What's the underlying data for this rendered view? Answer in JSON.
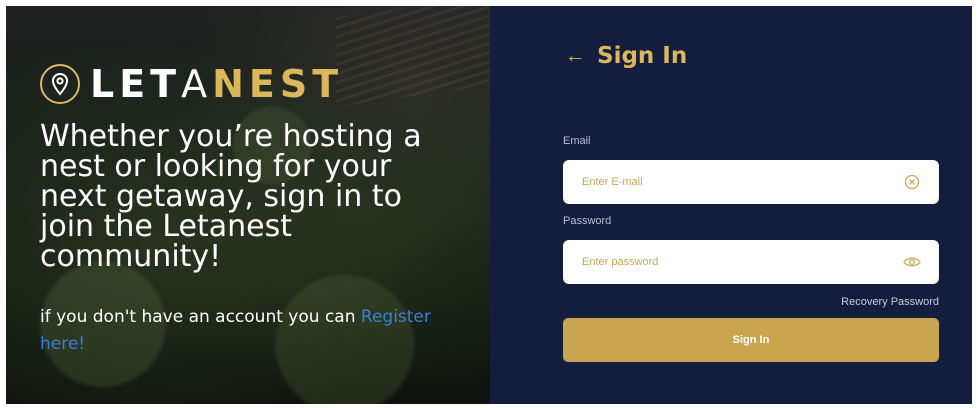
{
  "brand": {
    "logo_letters": [
      "LET",
      "A",
      "NEST"
    ],
    "gold_color": "#d9b75a"
  },
  "hero": {
    "headline_lines": [
      "Whether you’re hosting a",
      "nest or looking for your",
      "next getaway, sign in to",
      "join the Letanest",
      "community!"
    ],
    "subline_prefix": "if you don't have an account you can ",
    "register_link": "Register here!"
  },
  "signin": {
    "title": "Sign In",
    "back_icon": "arrow-left-icon",
    "email": {
      "label": "Email",
      "placeholder": "Enter E-mail",
      "value": "",
      "icon": "clear-circle-icon"
    },
    "password": {
      "label": "Password",
      "placeholder": "Enter password",
      "value": "",
      "icon": "eye-icon"
    },
    "recovery_label": "Recovery Password",
    "submit_label": "Sign In",
    "panel_color": "#141d3d",
    "button_color": "#c9a550"
  }
}
